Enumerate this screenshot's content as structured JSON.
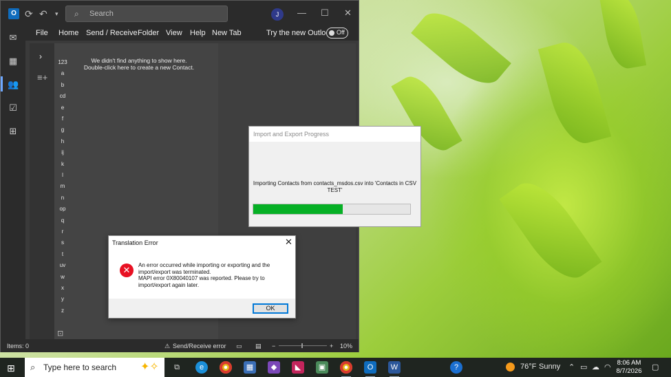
{
  "outlook": {
    "search_placeholder": "Search",
    "avatar_initial": "J",
    "ribbon_tabs": [
      "File",
      "Home",
      "Send / Receive",
      "Folder",
      "View",
      "Help",
      "New Tab"
    ],
    "try_new_outlook": "Try the new Outlook",
    "toggle_state": "Off",
    "alphabet_index": [
      "123",
      "a",
      "b",
      "cd",
      "e",
      "f",
      "g",
      "h",
      "ij",
      "k",
      "l",
      "m",
      "n",
      "op",
      "q",
      "r",
      "s",
      "t",
      "uv",
      "w",
      "x",
      "y",
      "z"
    ],
    "empty_message_line1": "We didn't find anything to show here.",
    "empty_message_line2": "Double-click here to create a new Contact.",
    "status_items": "Items: 0",
    "status_sendreceive": "Send/Receive error",
    "zoom_level": "10%"
  },
  "progress_dialog": {
    "title": "Import and Export Progress",
    "message": "Importing Contacts from contacts_msdos.csv into 'Contacts in CSV TEST'",
    "progress_fraction": 0.57
  },
  "error_dialog": {
    "title": "Translation Error",
    "message_line1": "An error occurred while importing  or exporting and the",
    "message_line2": "import/export was terminated.",
    "message_line3": "MAPI error 0X80040107 was reported.  Please try to",
    "message_line4": "import/export again later.",
    "ok_label": "OK"
  },
  "taskbar": {
    "search_placeholder": "Type here to search",
    "weather_temp": "76°F",
    "weather_desc": "Sunny",
    "time": "8:06 AM",
    "date": "8/7/2026"
  },
  "colors": {
    "progress_fill": "#06b025",
    "error_red": "#e81123",
    "accent_blue": "#0078d7"
  }
}
